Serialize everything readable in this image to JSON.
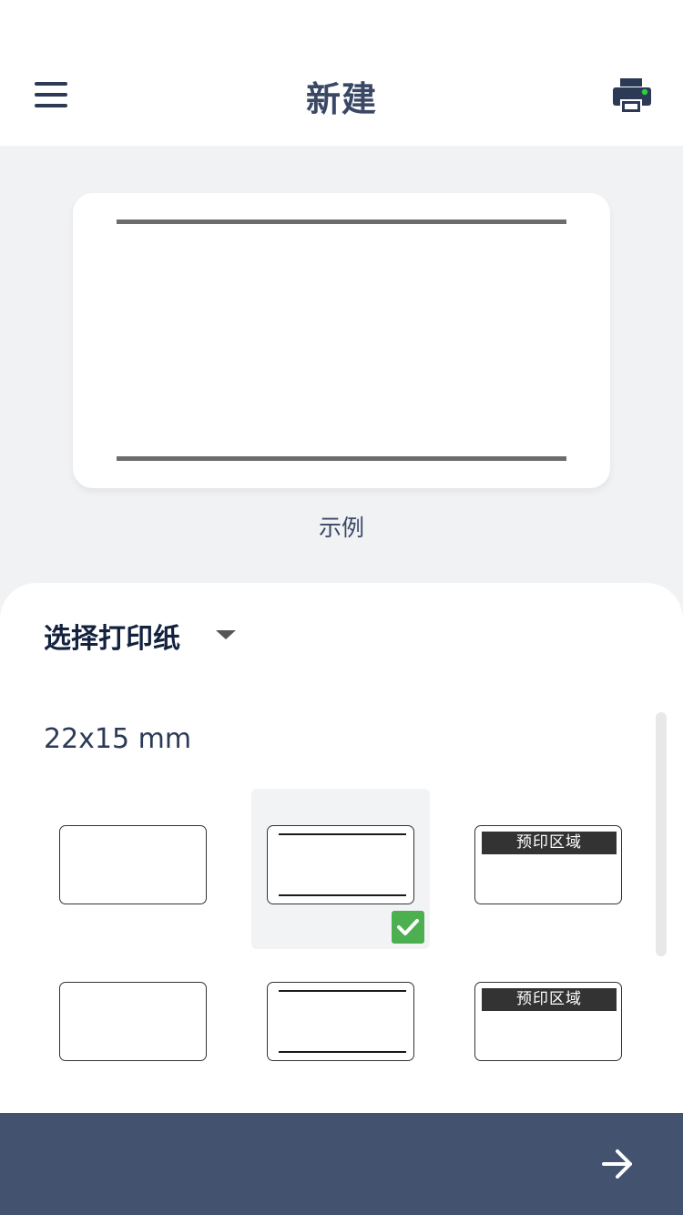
{
  "header": {
    "title": "新建",
    "menu_icon": "hamburger-menu-icon",
    "printer_icon": "printer-icon",
    "printer_status_color": "#2ecc40"
  },
  "preview": {
    "caption": "示例"
  },
  "paper_selector": {
    "label": "选择打印纸",
    "caret_icon": "chevron-down-icon",
    "size": "22x15 mm",
    "options": [
      {
        "style": "plain",
        "selected": false
      },
      {
        "style": "two-lines",
        "selected": true
      },
      {
        "style": "preprinted",
        "text": "预印区域",
        "selected": false
      },
      {
        "style": "plain",
        "selected": false
      },
      {
        "style": "two-lines",
        "selected": false
      },
      {
        "style": "preprinted",
        "text": "预印区域",
        "selected": false
      }
    ]
  },
  "colors": {
    "accent": "#42526f",
    "check": "#4caf50"
  },
  "footer": {
    "next_icon": "arrow-right-icon"
  }
}
